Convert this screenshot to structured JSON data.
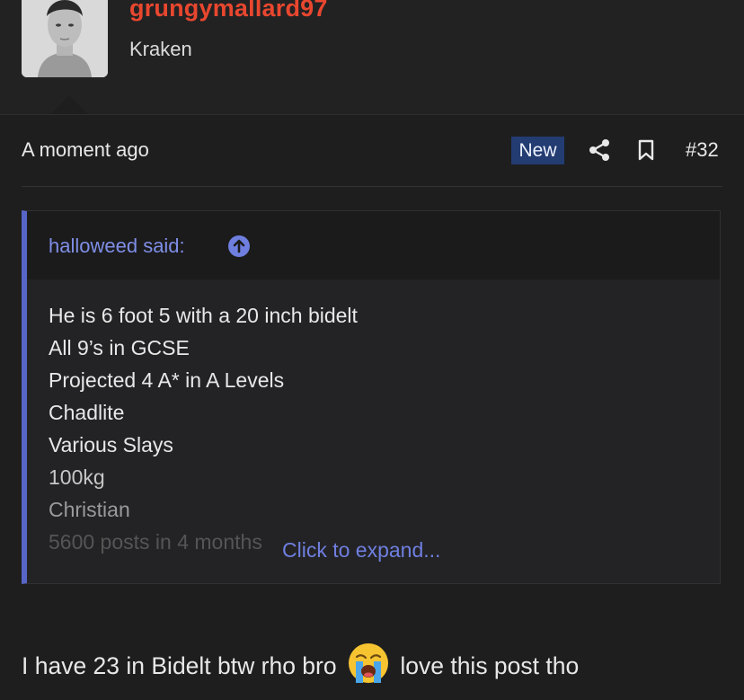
{
  "post": {
    "username": "grungymallard97",
    "user_title": "Kraken",
    "timestamp": "A moment ago",
    "new_badge": "New",
    "post_number": "#32"
  },
  "quote": {
    "author_label": "halloweed said:",
    "lines": [
      "He is 6 foot 5 with a 20 inch bidelt",
      "All 9’s in GCSE",
      "Projected 4 A* in A Levels",
      "Chadlite",
      "Various Slays",
      "100kg",
      "Christian",
      "5600 posts in 4 months"
    ],
    "expand_label": "Click to expand..."
  },
  "reply": {
    "text_before": "I have 23 in Bidelt btw rho bro",
    "emoji": "loudly-crying-face",
    "text_after": "love this post tho"
  },
  "colors": {
    "username": "#e9472f",
    "accent": "#5865c8",
    "link": "#6f7fe0",
    "badge_bg": "#233c72",
    "background": "#1e1e1f"
  },
  "icons": [
    "share-icon",
    "bookmark-icon",
    "arrow-up-circle-icon"
  ]
}
